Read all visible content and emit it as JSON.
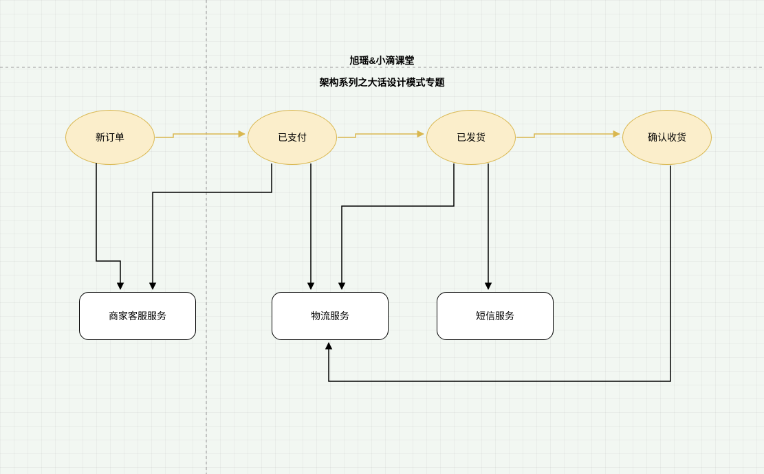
{
  "header": {
    "title1": "旭瑶&小滴课堂",
    "title2": "架构系列之大话设计模式专题"
  },
  "states": {
    "new_order": "新订单",
    "paid": "已支付",
    "shipped": "已发货",
    "confirmed": "确认收货"
  },
  "services": {
    "merchant_cs": "商家客服服务",
    "logistics": "物流服务",
    "sms": "短信服务"
  },
  "colors": {
    "ellipse_fill": "#fbeecb",
    "ellipse_border": "#d9b74f",
    "canvas_bg": "#f2f7f2",
    "transition_arrow": "#d9b74f",
    "call_arrow": "#000000"
  },
  "diagram": {
    "type": "state-transition",
    "state_nodes": [
      "new_order",
      "paid",
      "shipped",
      "confirmed"
    ],
    "service_nodes": [
      "merchant_cs",
      "logistics",
      "sms"
    ],
    "state_transitions": [
      {
        "from": "new_order",
        "to": "paid"
      },
      {
        "from": "paid",
        "to": "shipped"
      },
      {
        "from": "shipped",
        "to": "confirmed"
      }
    ],
    "service_calls": [
      {
        "from": "new_order",
        "to": "merchant_cs"
      },
      {
        "from": "paid",
        "to": "merchant_cs"
      },
      {
        "from": "paid",
        "to": "logistics"
      },
      {
        "from": "shipped",
        "to": "logistics"
      },
      {
        "from": "shipped",
        "to": "sms"
      },
      {
        "from": "confirmed",
        "to": "logistics"
      }
    ]
  }
}
